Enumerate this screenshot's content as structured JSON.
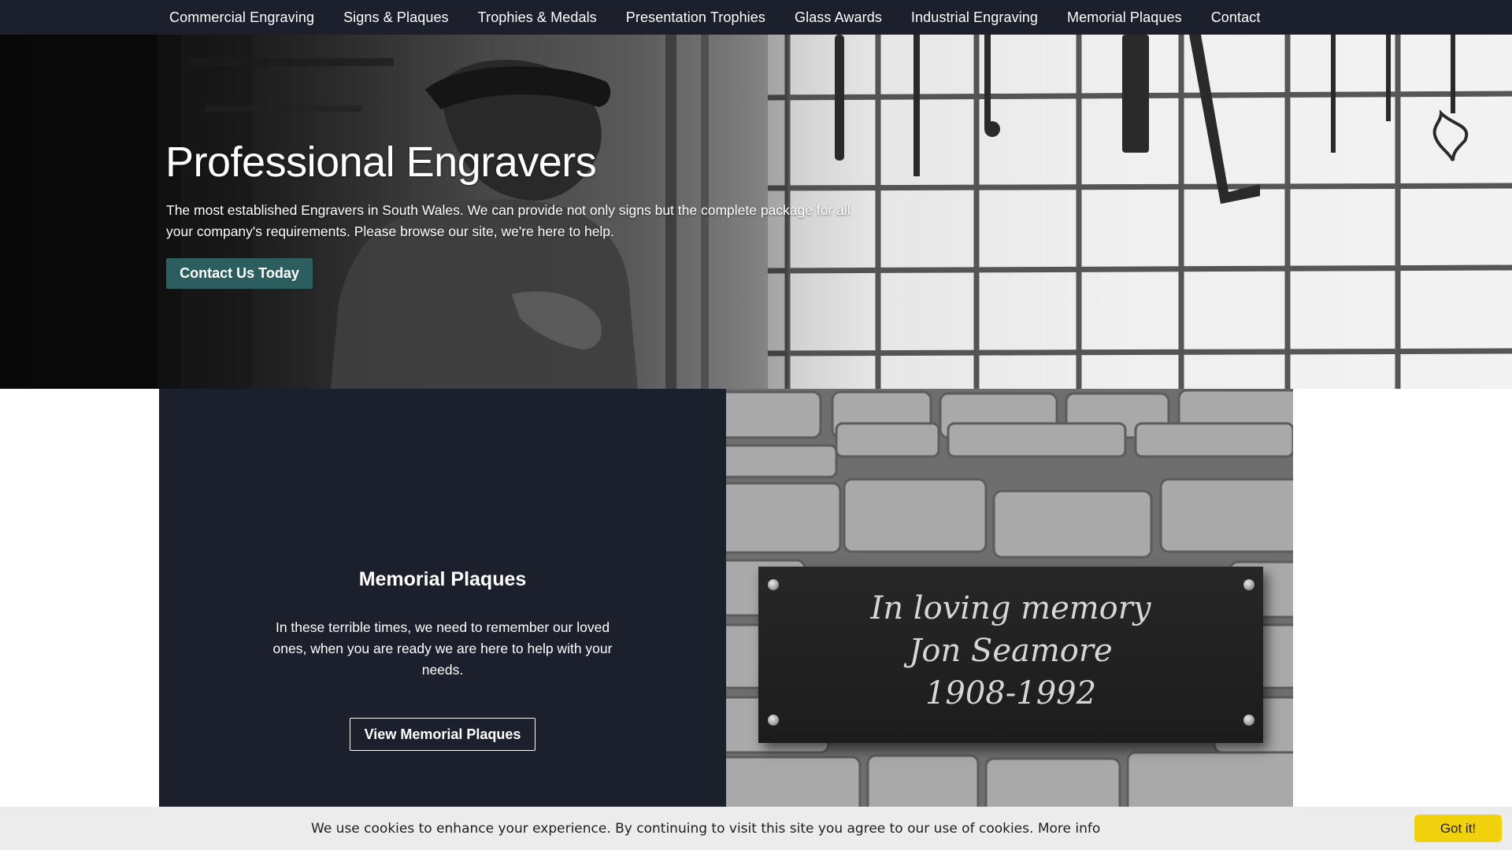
{
  "nav": {
    "items": [
      {
        "label": "Commercial Engraving"
      },
      {
        "label": "Signs & Plaques"
      },
      {
        "label": "Trophies & Medals"
      },
      {
        "label": "Presentation Trophies"
      },
      {
        "label": "Glass Awards"
      },
      {
        "label": "Industrial Engraving"
      },
      {
        "label": "Memorial Plaques"
      },
      {
        "label": "Contact"
      }
    ]
  },
  "hero": {
    "title": "Professional Engravers",
    "text": "The most established Engravers in South Wales. We can provide not only signs but the complete package for all your company's requirements. Please browse our site, we're here to help.",
    "button": "Contact Us Today"
  },
  "feature": {
    "title": "Memorial Plaques",
    "text": "In these terrible times, we need to remember our loved ones, when you are ready we are here to help with your needs.",
    "button": "View Memorial Plaques",
    "plaque_lines": [
      "In loving memory",
      "Jon Seamore",
      "1908-1992"
    ]
  },
  "cookie": {
    "text": "We use cookies to enhance your experience. By continuing to visit this site you agree to our use of cookies.",
    "link": "More info",
    "button": "Got it!"
  },
  "colors": {
    "nav_bg": "#1b202c",
    "accent_button": "#2c5d5f",
    "cookie_button": "#f0d10c"
  }
}
